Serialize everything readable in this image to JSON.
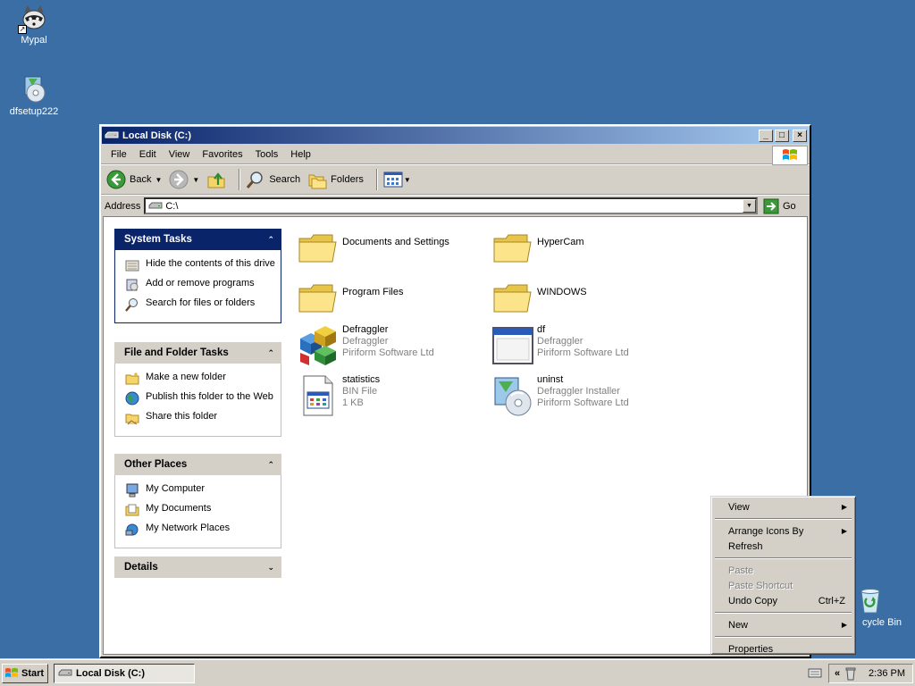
{
  "desktop": {
    "icons": [
      {
        "label": "Mypal",
        "icon": "raccoon-icon"
      },
      {
        "label": "dfsetup222",
        "icon": "installer-icon"
      },
      {
        "label": "cycle Bin",
        "icon": "recycle-bin-icon"
      }
    ]
  },
  "window": {
    "title": "Local Disk (C:)",
    "controls": {
      "minimize": "_",
      "maximize": "□",
      "close": "×"
    },
    "menu": [
      "File",
      "Edit",
      "View",
      "Favorites",
      "Tools",
      "Help"
    ],
    "toolbar": {
      "back": "Back",
      "search": "Search",
      "folders": "Folders"
    },
    "address": {
      "label": "Address",
      "value": "C:\\",
      "go": "Go"
    }
  },
  "task_pane": {
    "system_tasks": {
      "title": "System Tasks",
      "items": [
        "Hide the contents of this drive",
        "Add or remove programs",
        "Search for files or folders"
      ]
    },
    "file_folder_tasks": {
      "title": "File and Folder Tasks",
      "items": [
        "Make a new folder",
        "Publish this folder to the Web",
        "Share this folder"
      ]
    },
    "other_places": {
      "title": "Other Places",
      "items": [
        "My Computer",
        "My Documents",
        "My Network Places"
      ]
    },
    "details": {
      "title": "Details"
    }
  },
  "files": [
    {
      "name": "Documents and Settings",
      "type": "folder"
    },
    {
      "name": "HyperCam",
      "type": "folder"
    },
    {
      "name": "Program Files",
      "type": "folder"
    },
    {
      "name": "WINDOWS",
      "type": "folder"
    },
    {
      "name": "Defraggler",
      "line2": "Defraggler",
      "line3": "Piriform Software Ltd",
      "type": "app"
    },
    {
      "name": "df",
      "line2": "Defraggler",
      "line3": "Piriform Software Ltd",
      "type": "window"
    },
    {
      "name": "statistics",
      "line2": "BIN File",
      "line3": "1 KB",
      "type": "bin"
    },
    {
      "name": "uninst",
      "line2": "Defraggler Installer",
      "line3": "Piriform Software Ltd",
      "type": "installer"
    }
  ],
  "context_menu": {
    "view": "View",
    "arrange": "Arrange Icons By",
    "refresh": "Refresh",
    "paste": "Paste",
    "paste_shortcut": "Paste Shortcut",
    "undo_copy": "Undo Copy",
    "undo_shortcut": "Ctrl+Z",
    "new": "New",
    "properties": "Properties"
  },
  "taskbar": {
    "start": "Start",
    "task": "Local Disk (C:)",
    "tray_chevron": "«",
    "clock": "2:36 PM"
  },
  "colors": {
    "desktop": "#3a6ea5",
    "titlebar": "#0a246a",
    "chrome": "#d4d0c8"
  }
}
